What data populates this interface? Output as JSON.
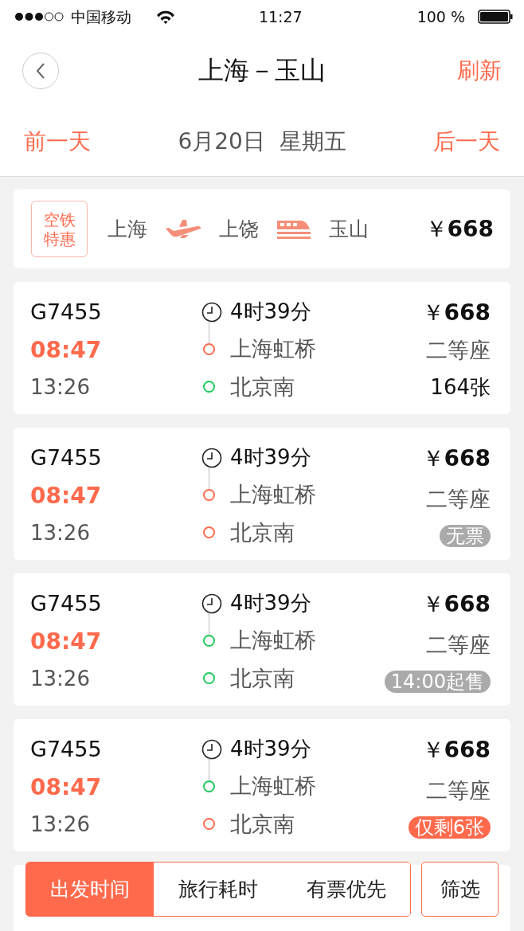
{
  "status_bar": {
    "carrier": "中国移动",
    "time": "11:27",
    "battery": "100 %"
  },
  "header": {
    "title": "上海－玉山",
    "refresh": "刷新"
  },
  "date_bar": {
    "prev": "前一天",
    "date": "6月20日  星期五",
    "next": "后一天"
  },
  "promo": {
    "badge": "空铁特惠",
    "legs": [
      {
        "kind": "city",
        "text": "上海"
      },
      {
        "kind": "plane"
      },
      {
        "kind": "city",
        "text": "上饶"
      },
      {
        "kind": "train"
      },
      {
        "kind": "city",
        "text": "玉山"
      }
    ],
    "currency": "￥",
    "price": "668"
  },
  "trains": [
    {
      "number": "G7455",
      "depart": "08:47",
      "arrive": "13:26",
      "duration": "4时39分",
      "from": {
        "name": "上海虹桥",
        "color": "#ff6a4d"
      },
      "to": {
        "name": "北京南",
        "color": "#1fc95c"
      },
      "currency": "￥",
      "price": "668",
      "seat": "二等座",
      "availability": {
        "kind": "count",
        "text": "164张"
      }
    },
    {
      "number": "G7455",
      "depart": "08:47",
      "arrive": "13:26",
      "duration": "4时39分",
      "from": {
        "name": "上海虹桥",
        "color": "#ff6a4d"
      },
      "to": {
        "name": "北京南",
        "color": "#ff6a4d"
      },
      "currency": "￥",
      "price": "668",
      "seat": "二等座",
      "availability": {
        "kind": "muted",
        "text": "无票"
      }
    },
    {
      "number": "G7455",
      "depart": "08:47",
      "arrive": "13:26",
      "duration": "4时39分",
      "from": {
        "name": "上海虹桥",
        "color": "#1fc95c"
      },
      "to": {
        "name": "北京南",
        "color": "#1fc95c"
      },
      "currency": "￥",
      "price": "668",
      "seat": "二等座",
      "availability": {
        "kind": "muted",
        "text": "14:00起售"
      }
    },
    {
      "number": "G7455",
      "depart": "08:47",
      "arrive": "13:26",
      "duration": "4时39分",
      "from": {
        "name": "上海虹桥",
        "color": "#1fc95c"
      },
      "to": {
        "name": "北京南",
        "color": "#ff6a4d"
      },
      "currency": "￥",
      "price": "668",
      "seat": "二等座",
      "availability": {
        "kind": "alert",
        "text": "仅剩6张"
      }
    }
  ],
  "sort_tabs": [
    {
      "label": "出发时间",
      "selected": true
    },
    {
      "label": "旅行耗时",
      "selected": false
    },
    {
      "label": "有票优先",
      "selected": false
    }
  ],
  "filter": "筛选"
}
